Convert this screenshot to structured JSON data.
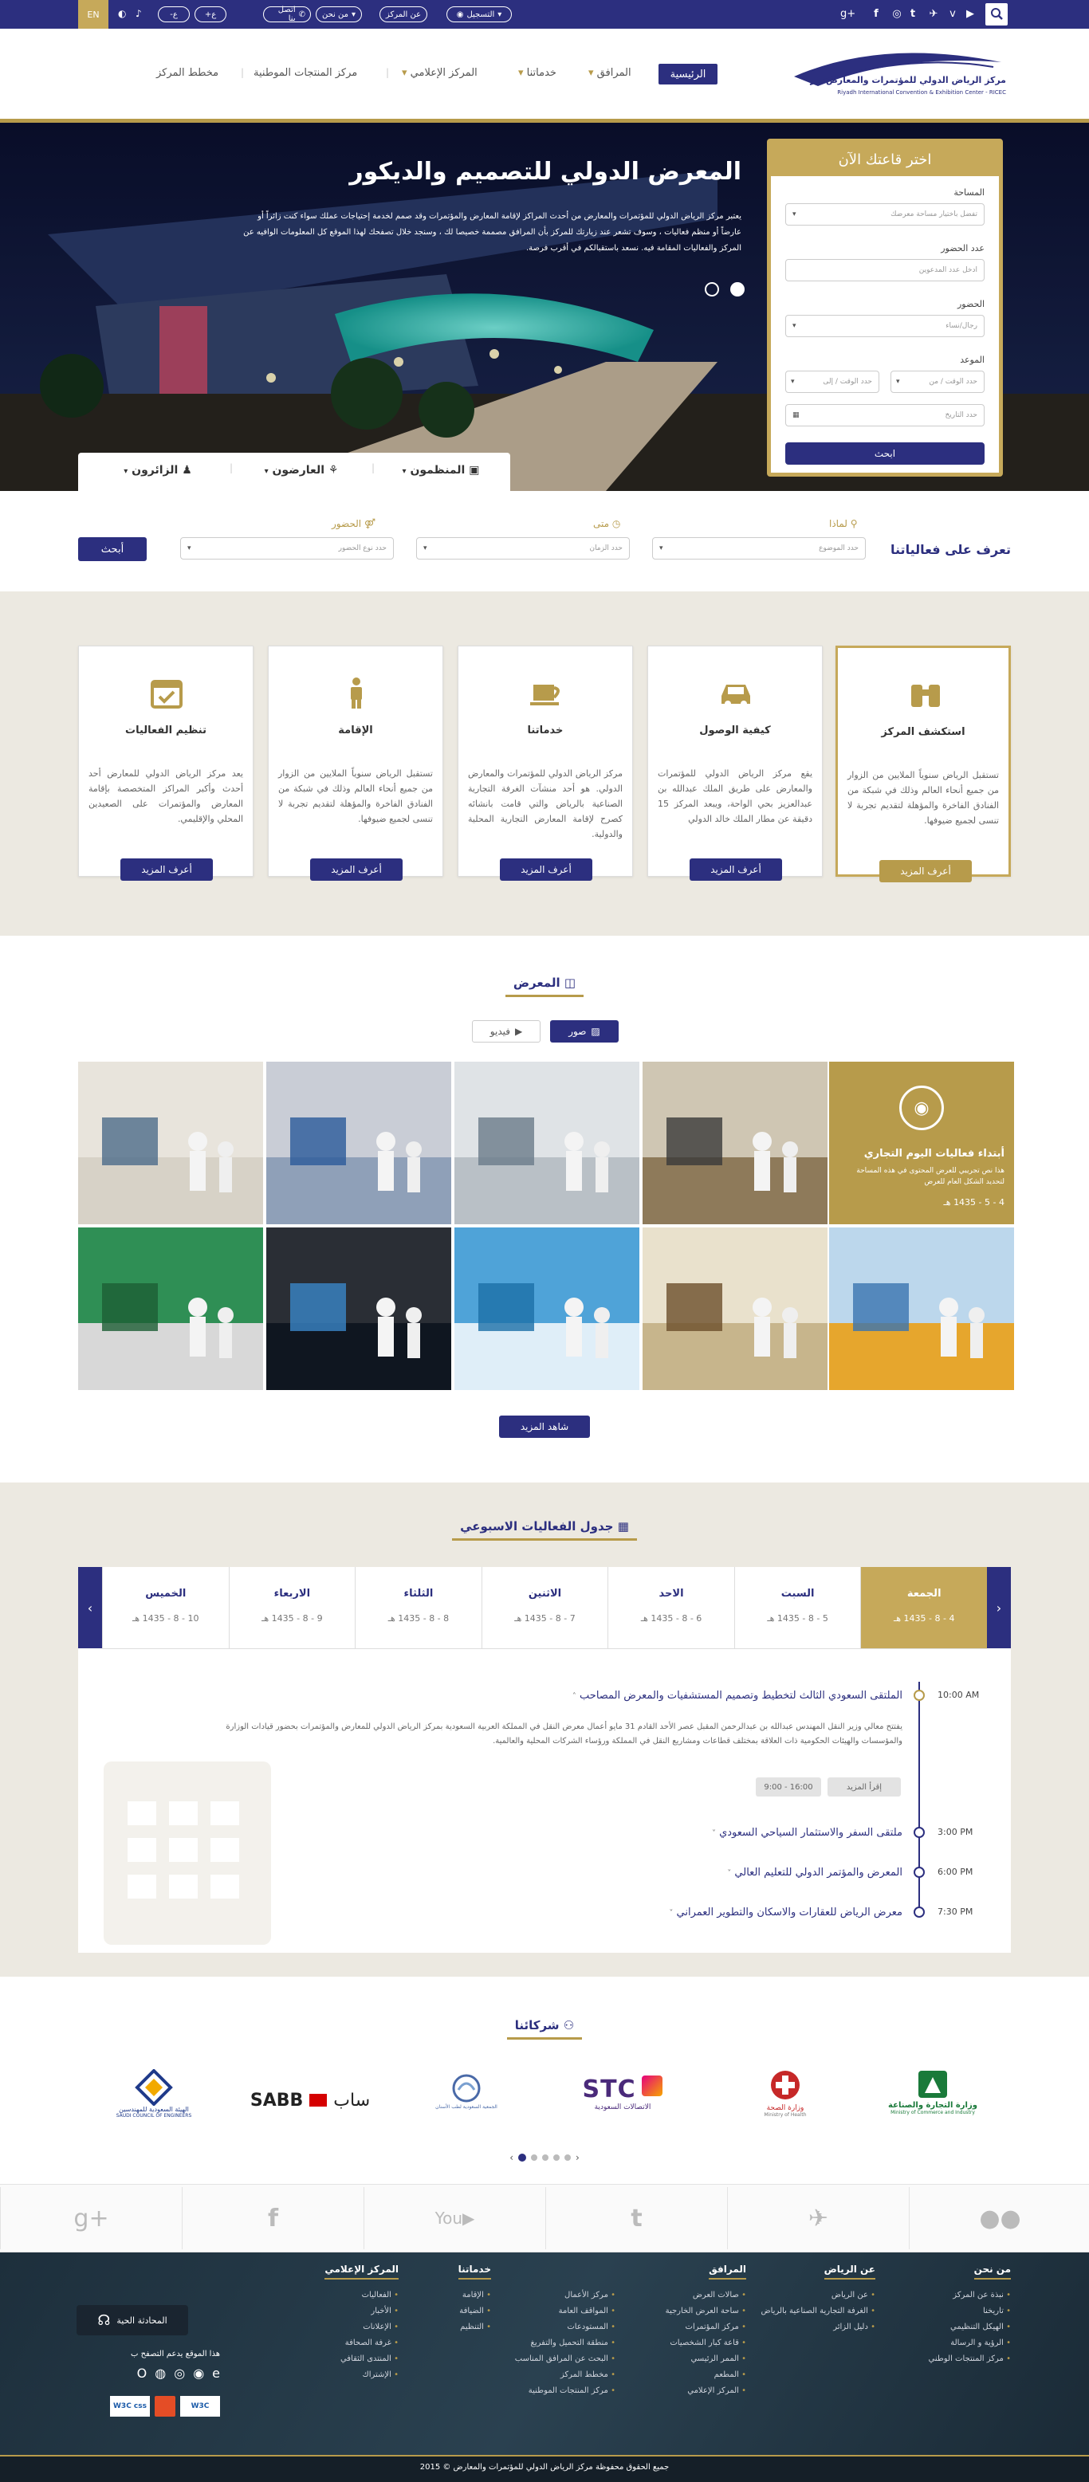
{
  "topbar": {
    "lang": "EN",
    "register": "التسجيل",
    "about": "عن المركز",
    "who": "من نحن",
    "contact": "اتصل بنا",
    "font_plus": "ع+",
    "font_minus": "ع-",
    "social_icons": [
      "search-icon",
      "youtube-icon",
      "vimeo-icon",
      "twitter-icon",
      "tumblr-icon",
      "rss-icon",
      "facebook-icon",
      "google-plus-icon"
    ]
  },
  "header": {
    "logo_ar": "مركز الرياض الدولي للمؤتمرات والمعارض",
    "logo_en": "Riyadh International Convention & Exhibition Center - RICEC",
    "nav": [
      "الرئيسية",
      "المرافق",
      "خدماتنا",
      "المركز الإعلامي",
      "مركز المنتجات الموطنية",
      "مخطط المركز"
    ]
  },
  "hero": {
    "title": "المعرض الدولي للتصميم والديكور",
    "desc": "يعتبر مركز الرياض الدولي للمؤتمرات والمعارض من أحدث المراكز لإقامة المعارض والمؤتمرات وقد صمم لخدمة إحتياجات عملك سواء كنت زائراً أو عارضاً أو منظم فعاليات ، وسوف تشعر عند زيارتك للمركز بأن المرافق مصممة خصيصا لك ، وسنجد خلال تصفحك لهذا الموقع كل المعلومات الوافيه عن المركز والفعاليات المقامة فيه. نسعد باستقبالكم في أقرب فرصة.",
    "tabs": [
      "المنظمون",
      "العارضون",
      "الزائرون"
    ]
  },
  "panel": {
    "title": "اختر قاعتك الآن",
    "area_label": "المساحة",
    "area_ph": "تفضل باختيار مساحة معرضك",
    "attend_label": "عدد الحضور",
    "attend_ph": "ادخل عدد المدعوين",
    "type_label": "الحضور",
    "type_ph": "رجال/نساء",
    "date_label": "الموعد",
    "from_ph": "حدد الوقت / من",
    "to_ph": "حدد الوقت / إلى",
    "date_ph": "حدد التاريخ",
    "search": "ابحث"
  },
  "filter": {
    "title": "تعرف على فعالياتنا",
    "why": "لماذا",
    "when": "متى",
    "attend": "الحضور",
    "topic_ph": "حدد الموضوع",
    "time_ph": "حدد الزمان",
    "type_ph": "حدد نوع الحضور",
    "search": "أبحث"
  },
  "cards": [
    {
      "title": "استكشف المركز",
      "text": "تستقبل الرياض سنوياً الملايين من الزوار من جميع أنحاء العالم وذلك في شبكة من الفنادق الفاخرة والمؤهلة لتقديم تجربة لا تنسى لجميع ضيوفها.",
      "more": "أعرف المزيد",
      "icon": "binoculars-icon"
    },
    {
      "title": "كيفية الوصول",
      "text": "يقع مركز الرياض الدولي للمؤتمرات والمعارض على طريق الملك عبدالله بن عبدالعزيز بحي الواحة، ويبعد المركز 15 دقيقة عن مطار الملك خالد الدولي",
      "more": "أعرف المزيد",
      "icon": "car-icon"
    },
    {
      "title": "خدماتنا",
      "text": "مركز الرياض الدولي للمؤتمرات والمعارض الدولي. هو أحد منشآت الغرفة التجارية الصناعية بالرياض والتي قامت بانشائه كصرح لإقامة المعارض التجارية المحلية والدولية.",
      "more": "أعرف المزيد",
      "icon": "cup-icon"
    },
    {
      "title": "الإقامة",
      "text": "تستقبل الرياض سنوياً الملايين من الزوار من جميع أنحاء العالم وذلك في شبكة من الفنادق الفاخرة والمؤهلة لتقديم تجربة لا تنسى لجميع ضيوفها.",
      "more": "أعرف المزيد",
      "icon": "person-icon"
    },
    {
      "title": "تنظيم الفعاليات",
      "text": "يعد مركز الرياض الدولي للمعارض أحد أحدث وأكبر المراكز المتخصصة بإقامة المعارض والمؤتمرات على الصعيدين المحلي والإقليمي.",
      "more": "أعرف المزيد",
      "icon": "calendar-check-icon"
    }
  ],
  "gallery": {
    "title": "المعرض",
    "photos": "صور",
    "videos": "فيديو",
    "featured_title": "أبتداء فعاليات اليوم التجاري",
    "featured_text": "هذا نص تجريبي للعرض المحتوى في هذه المساحة لتحديد الشكل العام للعرض",
    "featured_date": "4 - 5 - 1435 هـ",
    "more": "شاهد المزيد"
  },
  "schedule": {
    "title": "جدول الفعاليات الاسبوعي",
    "days": [
      {
        "name": "الجمعة",
        "date": "4 - 8 - 1435 هـ"
      },
      {
        "name": "السبت",
        "date": "5 - 8 - 1435 هـ"
      },
      {
        "name": "الاحد",
        "date": "6 - 8 - 1435 هـ"
      },
      {
        "name": "الاثنين",
        "date": "7 - 8 - 1435 هـ"
      },
      {
        "name": "الثلثاء",
        "date": "8 - 8 - 1435 هـ"
      },
      {
        "name": "الاربعاء",
        "date": "9 - 8 - 1435 هـ"
      },
      {
        "name": "الخميس",
        "date": "10 - 8 - 1435 هـ"
      }
    ],
    "events": [
      {
        "time": "10:00 AM",
        "title": "الملتقى السعودي الثالث لتخطيط وتصميم المستشفيات والمعرض المصاحب"
      },
      {
        "time": "3:00 PM",
        "title": "ملتقى السفر والاستثمار السياحي السعودي"
      },
      {
        "time": "6:00 PM",
        "title": "المعرض والمؤتمر الدولي للتعليم العالي"
      },
      {
        "time": "7:30 PM",
        "title": "معرض الرياض للعقارات والاسكان والتطوير العمراني"
      }
    ],
    "event_desc": "يفتتح معالي وزير النقل المهندس عبدالله بن عبدالرحمن المقبل عصر الأحد القادم 31 مايو أعمال معرض النقل في المملكة العربية السعودية بمركز الرياض الدولي للمعارض والمؤتمرات بحضور قيادات الوزارة والمؤسسات والهيئات الحكومية ذات العلاقة بمختلف قطاعات ومشاريع النقل في المملكة ورؤساء الشركات المحلية والعالمية.",
    "read_more": "إقرأ المزيد",
    "time_range": "9:00 - 16:00"
  },
  "partners": {
    "title": "شركائنا",
    "logos": [
      "وزارة التجارة والصناعة",
      "Ministry of Commerce and Industry",
      "وزارة الصحة",
      "Ministry of Health",
      "STC",
      "الاتصالات السعودية",
      "الجمعية السعودية لطب الأسنان",
      "SABB",
      "ساب",
      "الهيئة السعودية للمهندسين",
      "SAUDI COUNCIL OF ENGINEERS"
    ]
  },
  "footer": {
    "cols": [
      {
        "title": "من نحن",
        "items": [
          "نبذة عن المركز",
          "تاريخنا",
          "الهيكل التنظيمي",
          "الرؤية و الرسالة",
          "مركز المنتجات الوطني"
        ]
      },
      {
        "title": "عن الرياض",
        "items": [
          "عن الرياض",
          "الغرفة التجارية الصناعية بالرياض",
          "دليل الزائر"
        ]
      },
      {
        "title": "المرافق",
        "items": [
          "صالات العرض",
          "ساحة العرض الخارجية",
          "مركز المؤتمرات",
          "قاعة كبار الشخصيات",
          "الممر الرئيسي",
          "المطعم",
          "المركز الإعلامي"
        ]
      },
      {
        "title": "",
        "items": [
          "مركز الأعمال",
          "المواقف العامة",
          "المستودعات",
          "منطقة التحميل والتفريغ",
          "البحث عن المرافق المناسب",
          "مخطط المركز",
          "مركز المنتجات الموطنية"
        ]
      },
      {
        "title": "خدماتنا",
        "items": [
          "الإقامة",
          "الضيافة",
          "التنظيم"
        ]
      },
      {
        "title": "المركز الإعلامي",
        "items": [
          "الفعاليات",
          "الأخبار",
          "الإعلانات",
          "غرفة الصحافة",
          "المنتدى الثقافي",
          "الإشتراك"
        ]
      }
    ],
    "chat": "المحادثة الحية",
    "browsers": "هذا الموقع يدعم التصفح ب",
    "copyright": "جميع الحقوق محفوظة مركز الرياض الدولي للمؤتمرات والمعارض © 2015"
  }
}
